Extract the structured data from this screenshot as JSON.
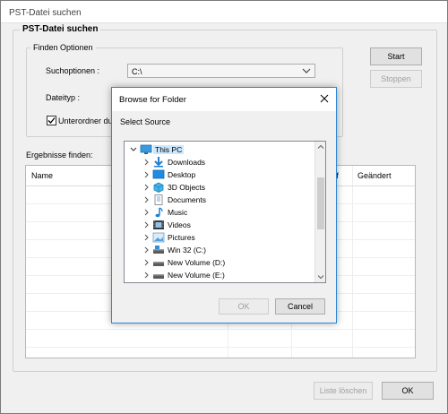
{
  "window": {
    "title": "PST-Datei suchen"
  },
  "main": {
    "group_title": "PST-Datei suchen",
    "find_options_title": "Finden Optionen",
    "search_options_label": "Suchoptionen :",
    "search_options_value": "C:\\",
    "file_type_label": "Dateityp :",
    "subfolder_checkbox_label": "Unterordner durc",
    "subfolder_checked": true,
    "results_label": "Ergebnisse finden:",
    "results_columns": [
      "Name",
      "ff",
      "Geändert"
    ]
  },
  "buttons": {
    "start": "Start",
    "stop": "Stoppen",
    "clear_list": "Liste löschen",
    "ok": "OK"
  },
  "dialog": {
    "title": "Browse for Folder",
    "subtitle": "Select Source",
    "ok": "OK",
    "cancel": "Cancel",
    "tree": [
      {
        "label": "This PC",
        "icon": "computer-icon",
        "expanded": true,
        "selected": true
      },
      {
        "label": "Downloads",
        "icon": "downloads-icon"
      },
      {
        "label": "Desktop",
        "icon": "desktop-icon"
      },
      {
        "label": "3D Objects",
        "icon": "3d-objects-icon"
      },
      {
        "label": "Documents",
        "icon": "documents-icon"
      },
      {
        "label": "Music",
        "icon": "music-icon"
      },
      {
        "label": "Videos",
        "icon": "videos-icon"
      },
      {
        "label": "Pictures",
        "icon": "pictures-icon"
      },
      {
        "label": "Win 32 (C:)",
        "icon": "drive-icon"
      },
      {
        "label": "New Volume (D:)",
        "icon": "drive-icon"
      },
      {
        "label": "New Volume (E:)",
        "icon": "drive-icon"
      }
    ]
  },
  "colors": {
    "accent": "#0078d7",
    "selection": "#cce8ff",
    "window_bg": "#f0f0f0"
  }
}
